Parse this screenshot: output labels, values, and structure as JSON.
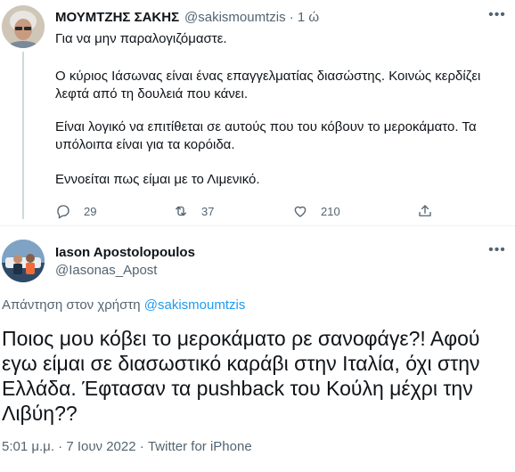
{
  "parent_tweet": {
    "author_name": "ΜΟΥΜΤΖΗΣ ΣΑΚΗΣ",
    "handle": "@sakismoumtzis",
    "separator": "·",
    "time": "1 ώ",
    "paragraphs": [
      "Για να μην παραλογιζόμαστε.",
      "Ο κύριος Ιάσωνας είναι ένας επαγγελματίας διασώστης. Κοινώς κερδίζει λεφτά από τη δουλειά που κάνει.",
      "Είναι λογικό να επιτίθεται σε αυτούς που του κόβουν το μεροκάματο. Τα υπόλοιπα είναι για τα κορόιδα.",
      "Εννοείται πως είμαι με το Λιμενικό."
    ],
    "replies": "29",
    "retweets": "37",
    "likes": "210"
  },
  "reply_tweet": {
    "author_name": "Iason Apostolopoulos",
    "handle": "@Iasonas_Apost",
    "replying_prefix": "Απάντηση στον χρήστη",
    "replying_to": "@sakismoumtzis",
    "text": "Ποιος μου κόβει το μεροκάματο ρε σανοφάγε?! Αφού εγω είμαι σε διασωστικό καράβι στην Ιταλία, όχι στην Ελλάδα. Έφτασαν τα pushback του Κούλη μέχρι την Λιβύη??",
    "time": "5:01 μ.μ.",
    "date": "7 Ιουν 2022",
    "source": "Twitter for iPhone",
    "dot": "·"
  },
  "icons": {
    "more": "more-icon",
    "reply": "reply-icon",
    "retweet": "retweet-icon",
    "like": "like-icon",
    "share": "share-icon"
  },
  "colors": {
    "text": "#0f1419",
    "muted": "#536471",
    "link": "#1d9bf0",
    "divider": "#eff3f4"
  }
}
